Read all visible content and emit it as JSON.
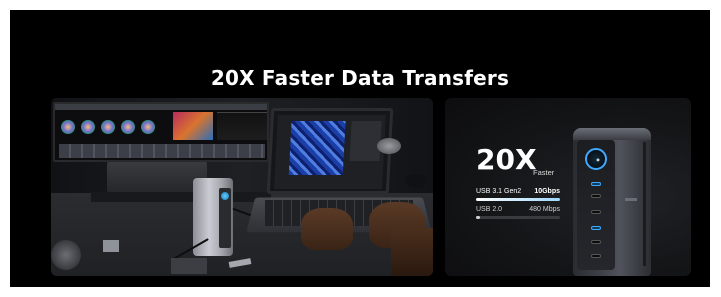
{
  "headline": "20X Faster Data Transfers",
  "photo_panel": {
    "image": "laptop-with-dock-desk-photo"
  },
  "product_panel": {
    "speed_number": "20X",
    "speed_suffix": "Faster",
    "rows": [
      {
        "name": "USB 3.1 Gen2",
        "value": "10Gbps",
        "level": 1.0
      },
      {
        "name": "USB 2.0",
        "value": "480 Mbps",
        "level": 0.05
      }
    ],
    "image": "docking-station-product-render"
  },
  "colors": {
    "background": "#000000",
    "page": "#ffffff",
    "text": "#ffffff",
    "accent": "#3fa9ff"
  }
}
